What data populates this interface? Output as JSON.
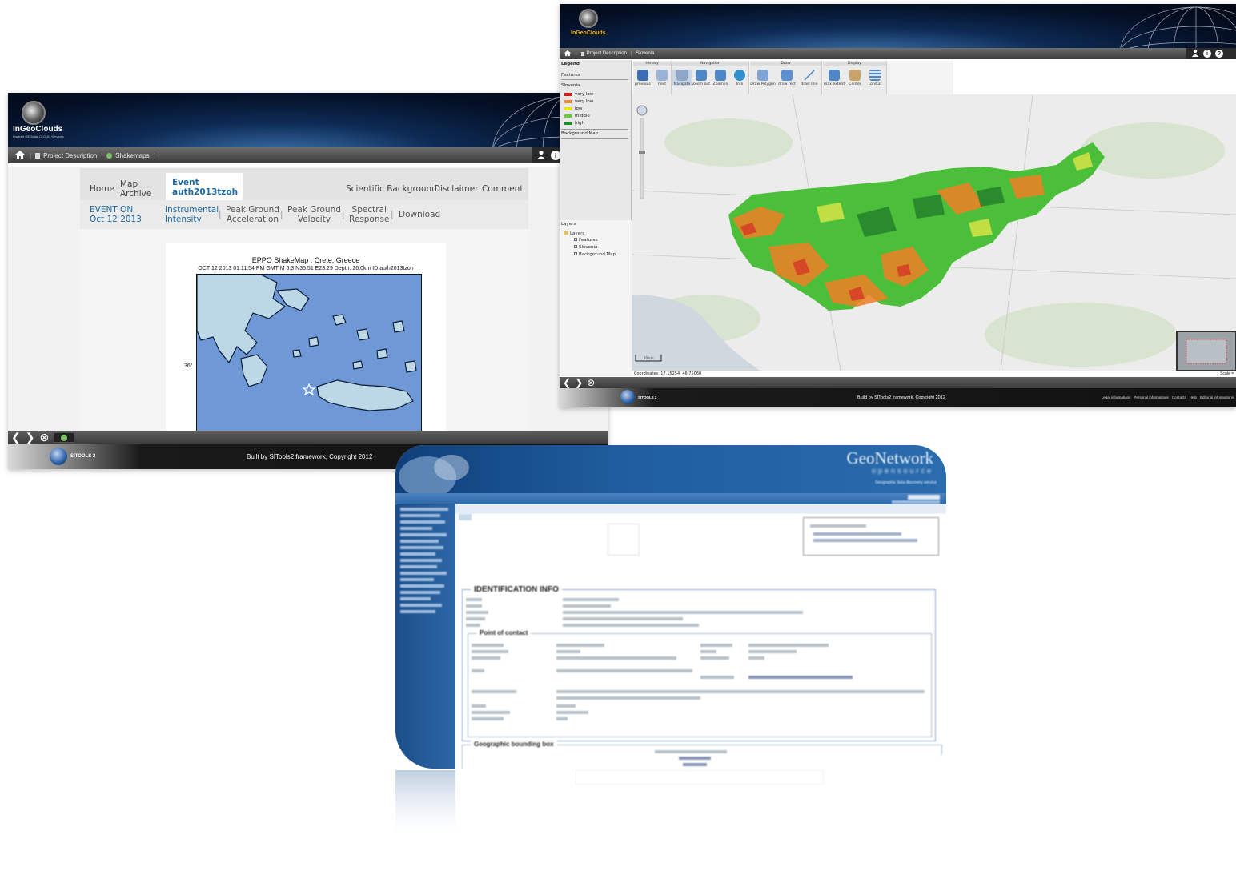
{
  "shakemaps_window": {
    "logo_text": "InGeoClouds",
    "logo_subtext": "Inspired GEOdata CLOUD Services",
    "breadcrumb": {
      "project": "Project Description",
      "page": "Shakemaps"
    },
    "tabs": {
      "home": "Home",
      "map_archive_line1": "Map",
      "map_archive_line2": "Archive",
      "event_line1": "Event",
      "event_line2": "auth2013tzoh",
      "scientific_background": "Scientific Background",
      "disclaimer": "Disclaimer",
      "comment": "Comment"
    },
    "subnav": {
      "event_on_line1": "EVENT ON",
      "event_on_line2": "Oct 12 2013",
      "instrumental_line1": "Instrumental",
      "instrumental_line2": "Intensity",
      "pga_line1": "Peak Ground",
      "pga_line2": "Acceleration",
      "pgv_line1": "Peak Ground",
      "pgv_line2": "Velocity",
      "spectral_line1": "Spectral",
      "spectral_line2": "Response",
      "download": "Download"
    },
    "map": {
      "title": "EPPO ShakeMap : Crete, Greece",
      "subtitle": "OCT 12 2013 01:11:54 PM GMT   M 6.3   N35.51 E23.29   Depth: 26.0km   ID:auth2013tzoh",
      "lat_label": "36°"
    },
    "footer": {
      "sitools_label": "SITOOLS 2",
      "copyright": "Built by SITools2 framework, Copyright 2012"
    }
  },
  "slovenia_window": {
    "logo_text": "InGeoClouds",
    "breadcrumb": {
      "project": "Project Description",
      "page": "Slovenia"
    },
    "legend": {
      "title": "Legend",
      "features": "Features",
      "layer_name": "Slovenia",
      "classes": [
        {
          "label": "very low",
          "color": "#d7191c"
        },
        {
          "label": "very low",
          "color": "#f08a24"
        },
        {
          "label": "low",
          "color": "#e6e600"
        },
        {
          "label": "middle",
          "color": "#66cc33"
        },
        {
          "label": "high",
          "color": "#1a8f2a"
        }
      ],
      "background_map": "Background Map"
    },
    "layers_panel": {
      "title": "Layers",
      "root": "Layers",
      "items": [
        "Features",
        "Slovenia",
        "Background Map"
      ]
    },
    "toolbar": {
      "groups": {
        "history": "History",
        "navigation": "Navigation",
        "draw": "Draw",
        "display": "Display"
      },
      "tools": [
        "previous",
        "next",
        "Navigate",
        "Zoom out",
        "Zoom in",
        "Info",
        "Draw Polygon",
        "draw rect",
        "draw line",
        "max extent",
        "Center",
        "Lon/Lat"
      ]
    },
    "map_labels": {
      "scale_bar": "20 km",
      "coordinates": "Coordinates: 17.15254, 46.75060",
      "scale": "Scale ="
    },
    "footer": {
      "sitools_label": "SITOOLS 2",
      "copyright": "Build by SITools2 framework, Copyright 2012",
      "links": [
        "Legal informations",
        "Personal informations",
        "Contacts",
        "Help",
        "Editorial informations"
      ]
    }
  },
  "geonetwork_window": {
    "brand": "GeoNetwork",
    "brand_sub": "opensource",
    "tagline": "Geographic data discovery service",
    "section_identification": "IDENTIFICATION INFO",
    "section_contact": "Point of contact",
    "section_bbox": "Geographic bounding box"
  },
  "colors": {
    "accent_blue": "#1c6aa8",
    "toolbar_dark": "#3b3b3b",
    "geonetwork_blue": "#1f5d9e"
  }
}
